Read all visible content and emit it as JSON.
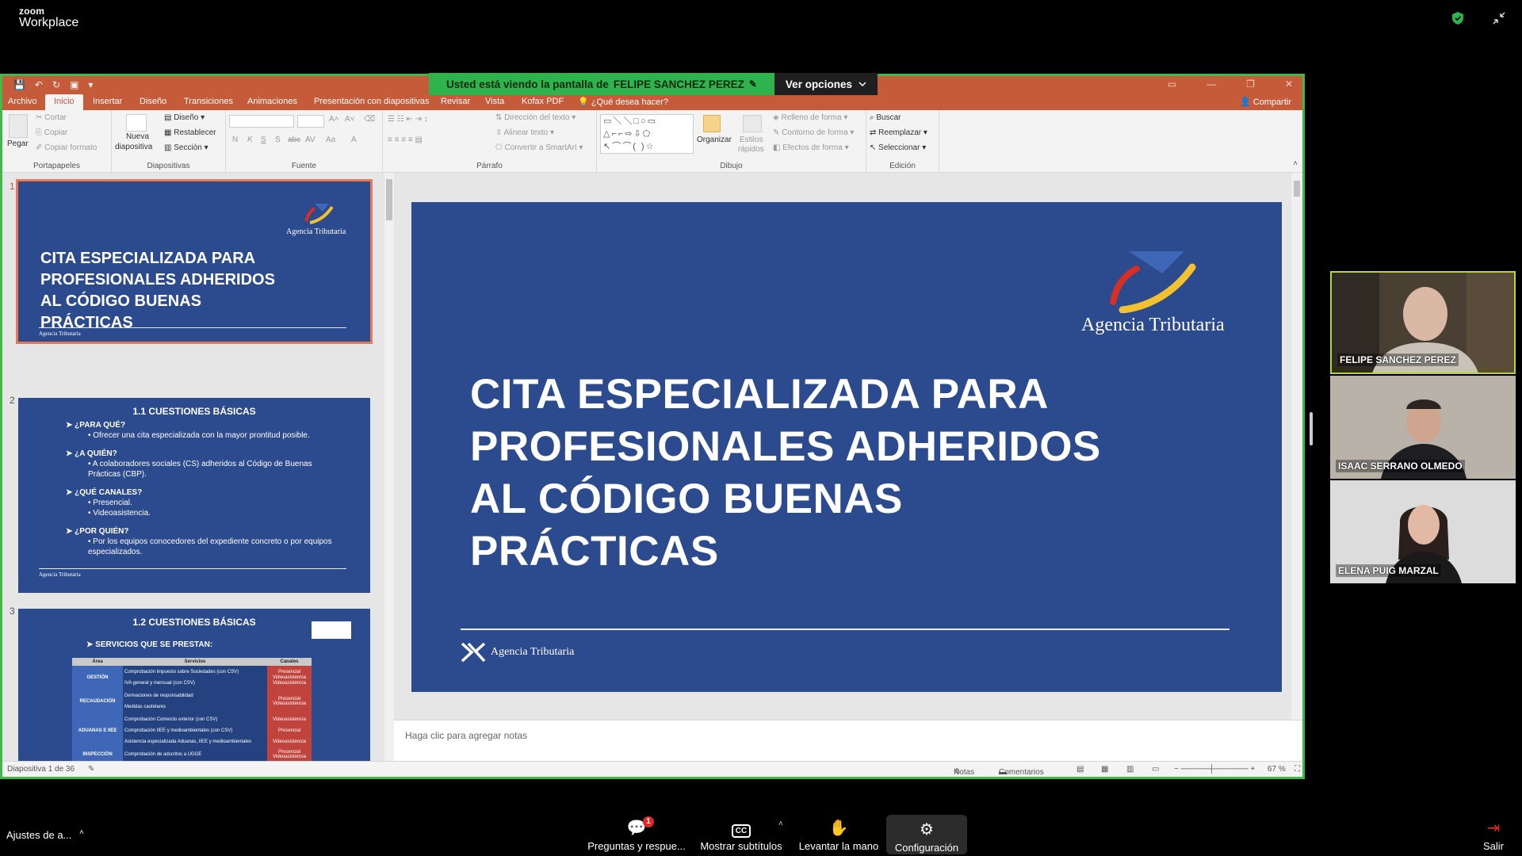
{
  "zoom": {
    "brand_top": "zoom",
    "brand_bottom": "Workplace",
    "share_banner": {
      "prefix": "Usted está viendo la pantalla de",
      "presenter": "FELIPE SANCHEZ PEREZ",
      "options_label": "Ver opciones"
    },
    "bottom_bar": {
      "audio_settings": "Ajustes de a...",
      "qa": "Preguntas y respue...",
      "qa_badge": "1",
      "captions": "Mostrar subtítulos",
      "raise_hand": "Levantar la mano",
      "settings": "Configuración",
      "leave": "Salir"
    },
    "participants": [
      {
        "name": "FELIPE SANCHEZ PEREZ",
        "active": true
      },
      {
        "name": "ISAAC SERRANO OLMEDO",
        "active": false
      },
      {
        "name": "ELENA PUIG MARZAL",
        "active": false
      }
    ],
    "colors": {
      "active_speaker": "#b7d43a",
      "share_border": "#3fb94a",
      "banner": "#2fb34c"
    }
  },
  "powerpoint": {
    "tabs": [
      "Archivo",
      "Inicio",
      "Insertar",
      "Diseño",
      "Transiciones",
      "Animaciones",
      "Presentación con diapositivas",
      "Revisar",
      "Vista",
      "Kofax PDF"
    ],
    "active_tab": "Inicio",
    "tell_me": "¿Qué desea hacer?",
    "share": "Compartir",
    "ribbon": {
      "paste": "Pegar",
      "cut": "Cortar",
      "copy": "Copiar",
      "format_painter": "Copiar formato",
      "group_clipboard": "Portapapeles",
      "new_slide_1": "Nueva",
      "new_slide_2": "diapositiva",
      "layout": "Diseño",
      "reset": "Restablecer",
      "section": "Sección",
      "group_slides": "Diapositivas",
      "group_font": "Fuente",
      "font_buttons": [
        "N",
        "K",
        "S",
        "S",
        "abc",
        "AV",
        "Aa",
        "A"
      ],
      "text_direction": "Dirección del texto",
      "align_text": "Alinear texto",
      "smartart": "Convertir a SmartArt",
      "group_paragraph": "Párrafo",
      "arrange": "Organizar",
      "quick_styles_1": "Estilos",
      "quick_styles_2": "rápidos",
      "shape_fill": "Relleno de forma",
      "shape_outline": "Contorno de forma",
      "shape_effects": "Efectos de forma",
      "group_drawing": "Dibujo",
      "find": "Buscar",
      "replace": "Reemplazar",
      "select": "Seleccionar",
      "group_editing": "Edición"
    },
    "slide": {
      "title_lines": [
        "CITA ESPECIALIZADA PARA",
        "PROFESIONALES ADHERIDOS",
        "AL CÓDIGO BUENAS",
        "PRÁCTICAS"
      ],
      "logo_text": "Agencia Tributaria"
    },
    "notes_placeholder": "Haga clic para agregar notas",
    "thumbnails": [
      {
        "num": "1",
        "title_lines": [
          "CITA ESPECIALIZADA PARA",
          "PROFESIONALES ADHERIDOS",
          "AL CÓDIGO BUENAS",
          "PRÁCTICAS"
        ],
        "logo_text": "Agencia Tributaria"
      },
      {
        "num": "2",
        "heading": "1.1 CUESTIONES BÁSICAS",
        "items": [
          {
            "q": "¿PARA QUÉ?",
            "a": [
              "Ofrecer una cita especializada con la mayor prontitud posible."
            ]
          },
          {
            "q": "¿A QUIÉN?",
            "a": [
              "A colaboradores sociales (CS) adheridos al Código de Buenas Prácticas (CBP)."
            ]
          },
          {
            "q": "¿QUÉ CANALES?",
            "a": [
              "Presencial.",
              "Videoasistencia."
            ]
          },
          {
            "q": "¿POR QUIÉN?",
            "a": [
              "Por los equipos conocedores del expediente concreto o por equipos especializados."
            ]
          }
        ]
      },
      {
        "num": "3",
        "heading": "1.2 CUESTIONES BÁSICAS",
        "subheading": "SERVICIOS QUE SE PRESTAN:",
        "table_headers": [
          "Área",
          "Servicios",
          "Canales"
        ],
        "rows": [
          {
            "area": "GESTIÓN",
            "services": [
              "Comprobación impuesto sobre Sociedades (con CSV)",
              "IVA general y mensual (con CSV)"
            ],
            "channels": [
              "Presencial Videoasistencia",
              "Videoasistencia"
            ]
          },
          {
            "area": "RECAUDACIÓN",
            "services": [
              "Derivaciones de responsabilidad",
              "Medidas cautelares"
            ],
            "channels": [
              "Presencial Videoasistencia"
            ]
          },
          {
            "area": "ADUANAS E IIEE",
            "services": [
              "Comprobación Comercio exterior (con CSV)",
              "Comprobación IIEE y medioambientales (con CSV)",
              "Asistencia especializada Aduanas, IIEE y medioambientales"
            ],
            "channels": [
              "Videoasistencia",
              "Presencial Videoasistencia"
            ]
          },
          {
            "area": "INSPECCIÓN",
            "services": [
              "Comprobación de adscritos a UGGE"
            ],
            "channels": [
              "Presencial Videoasistencia"
            ]
          }
        ]
      }
    ],
    "status": {
      "slide_counter": "Diapositiva 1 de 36",
      "notes": "Notas",
      "comments": "Comentarios",
      "zoom": "67 %"
    },
    "colors": {
      "title_bar": "#c65b3a",
      "slide_bg": "#2c4a8e",
      "logo_red": "#d62f25",
      "logo_yellow": "#f2c12e"
    }
  }
}
